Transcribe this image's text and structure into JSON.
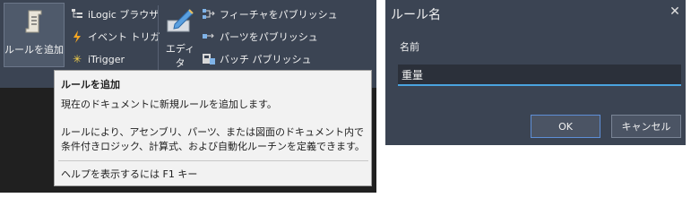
{
  "ribbon": {
    "add_rule_label": "ルールを追加",
    "items_col1": [
      {
        "label": "iLogic ブラウザ",
        "icon": "browser-icon"
      },
      {
        "label": "イベント トリガ",
        "icon": "lightning-icon"
      },
      {
        "label": "iTrigger",
        "icon": "spark-icon"
      }
    ],
    "editor_label": "エディタ",
    "items_col2": [
      {
        "label": "フィーチャをパブリッシュ",
        "icon": "publish-feature-icon"
      },
      {
        "label": "パーツをパブリッシュ",
        "icon": "publish-parts-icon"
      },
      {
        "label": "バッチ パブリッシュ",
        "icon": "batch-publish-icon"
      }
    ]
  },
  "tooltip": {
    "title": "ルールを追加",
    "description": "現在のドキュメントに新規ルールを追加します。",
    "body": "ルールにより、アセンブリ、パーツ、または図面のドキュメント内で条件付きロジック、計算式、および自動化ルーチンを定義できます。",
    "help": "ヘルプを表示するには F1 キー"
  },
  "dialog": {
    "title": "ルール名",
    "close_icon": "close-icon",
    "field_label": "名前",
    "field_value": "重量",
    "ok_label": "OK",
    "cancel_label": "キャンセル",
    "accent_color": "#4aa3df"
  }
}
